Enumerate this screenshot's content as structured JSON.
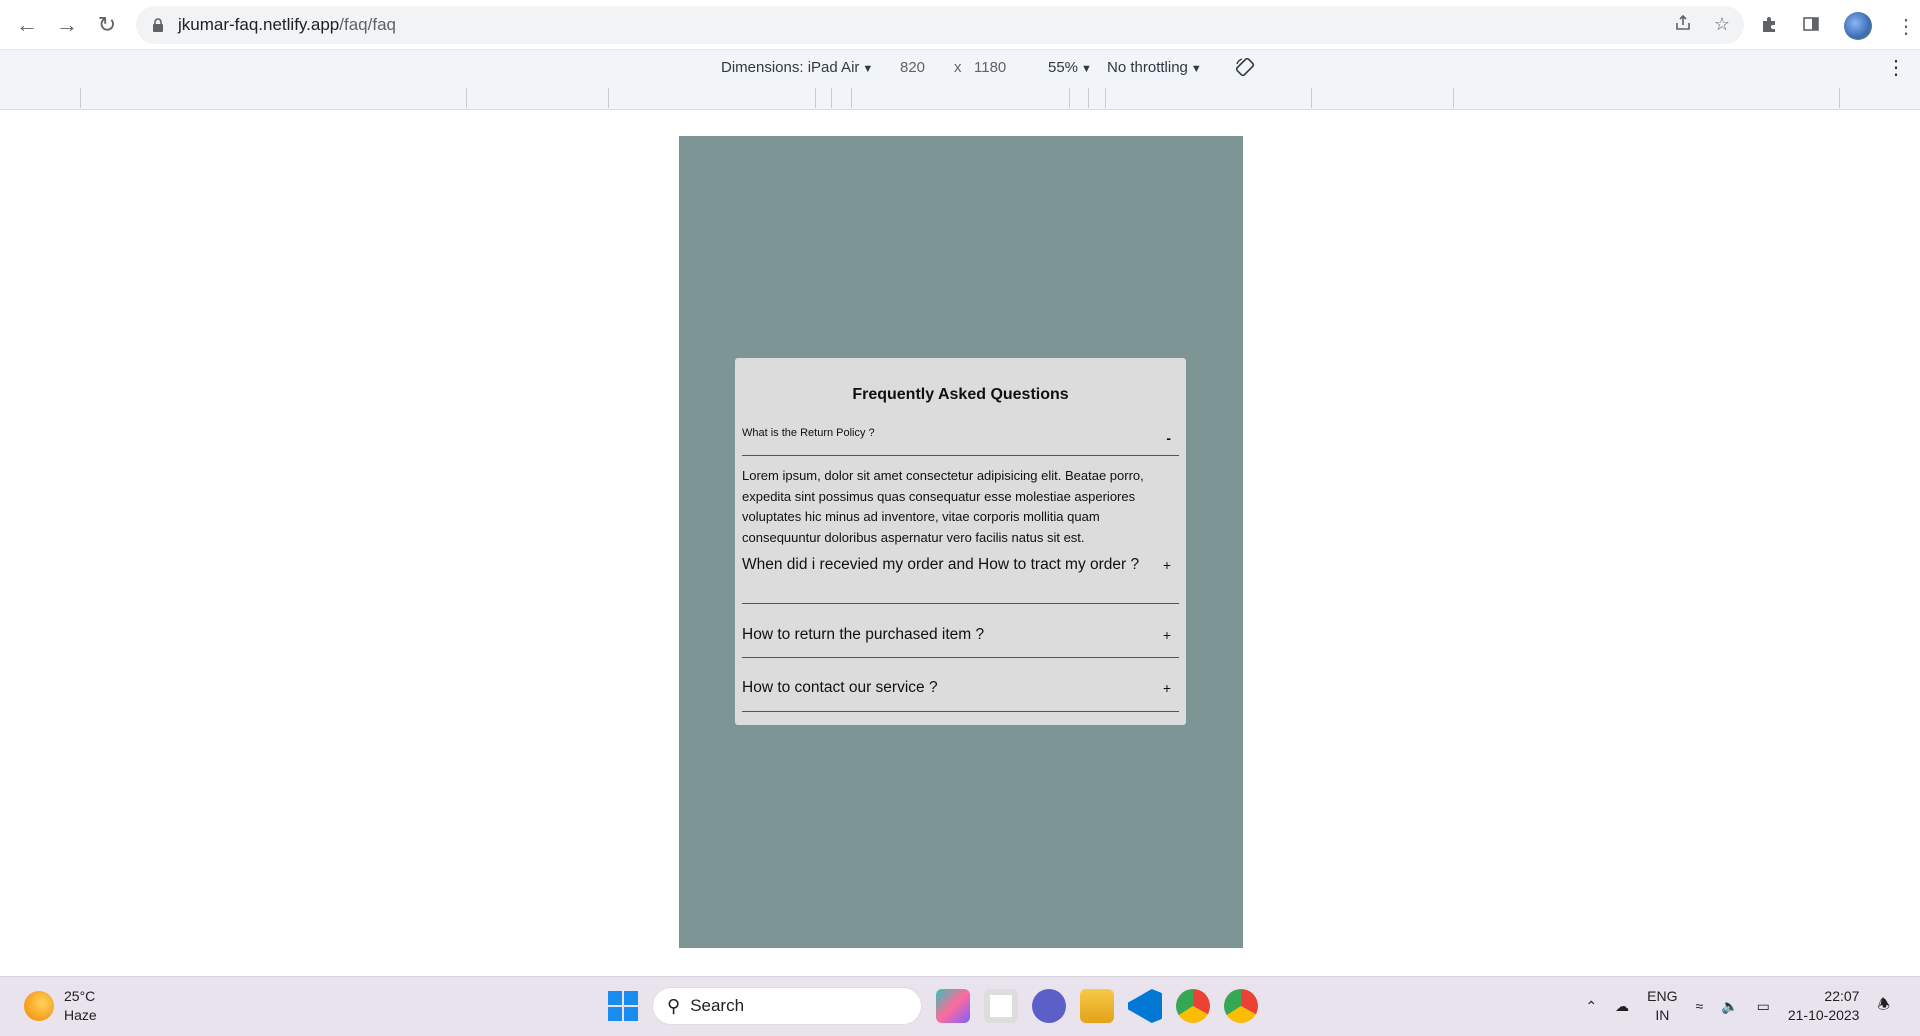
{
  "browser": {
    "url_host": "jkumar-faq.netlify.app",
    "url_path": "/faq/faq"
  },
  "devtools": {
    "dimensions_label": "Dimensions: iPad Air",
    "width": "820",
    "times": "x",
    "height": "1180",
    "zoom": "55%",
    "throttling": "No throttling"
  },
  "faq": {
    "title": "Frequently Asked Questions",
    "items": [
      {
        "question": "What is the Return Policy ?",
        "toggle": "-",
        "answer": "Lorem ipsum, dolor sit amet consectetur adipisicing elit. Beatae porro, expedita sint possimus quas consequatur esse molestiae asperiores voluptates hic minus ad inventore, vitae corporis mollitia quam consequuntur doloribus aspernatur vero facilis natus sit est."
      },
      {
        "question": "When did i recevied my order and How to tract my order ?",
        "toggle": "+"
      },
      {
        "question": "How to return the purchased item ?",
        "toggle": "+"
      },
      {
        "question": "How to contact our service ?",
        "toggle": "+"
      }
    ]
  },
  "taskbar": {
    "weather_temp": "25°C",
    "weather_desc": "Haze",
    "search_label": "Search",
    "lang_line1": "ENG",
    "lang_line2": "IN",
    "time": "22:07",
    "date": "21-10-2023"
  },
  "colors": {
    "device_bg": "#7e9596",
    "card_bg": "#dcdcdc"
  }
}
